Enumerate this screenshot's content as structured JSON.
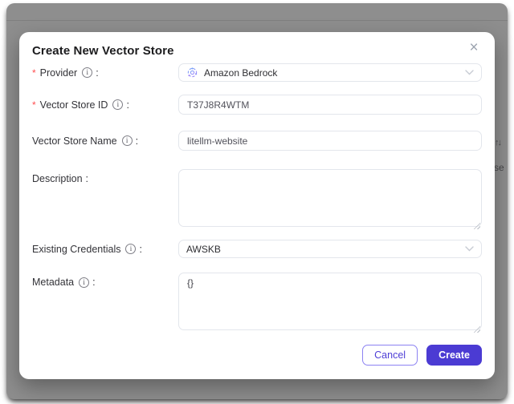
{
  "background": {
    "sort_icon": "↑↓",
    "truncated_text": "se"
  },
  "modal": {
    "title": "Create New Vector Store",
    "close_glyph": "×",
    "colon": ":",
    "required_marker": "*",
    "info_glyph": "i",
    "fields": {
      "provider": {
        "label": "Provider",
        "value": "Amazon Bedrock"
      },
      "vector_store_id": {
        "label": "Vector Store ID",
        "value": "T37J8R4WTM"
      },
      "vector_store_name": {
        "label": "Vector Store Name",
        "value": "litellm-website"
      },
      "description": {
        "label": "Description",
        "value": ""
      },
      "existing_credentials": {
        "label": "Existing Credentials",
        "value": "AWSKB"
      },
      "metadata": {
        "label": "Metadata",
        "value": "{}"
      }
    },
    "footer": {
      "cancel": "Cancel",
      "create": "Create"
    }
  },
  "colors": {
    "primary_button": "#4b3bd3",
    "cancel_text": "#4e3ed6",
    "required_asterisk": "#ff4d4f",
    "overlay_gray": "#8e8e8e"
  }
}
